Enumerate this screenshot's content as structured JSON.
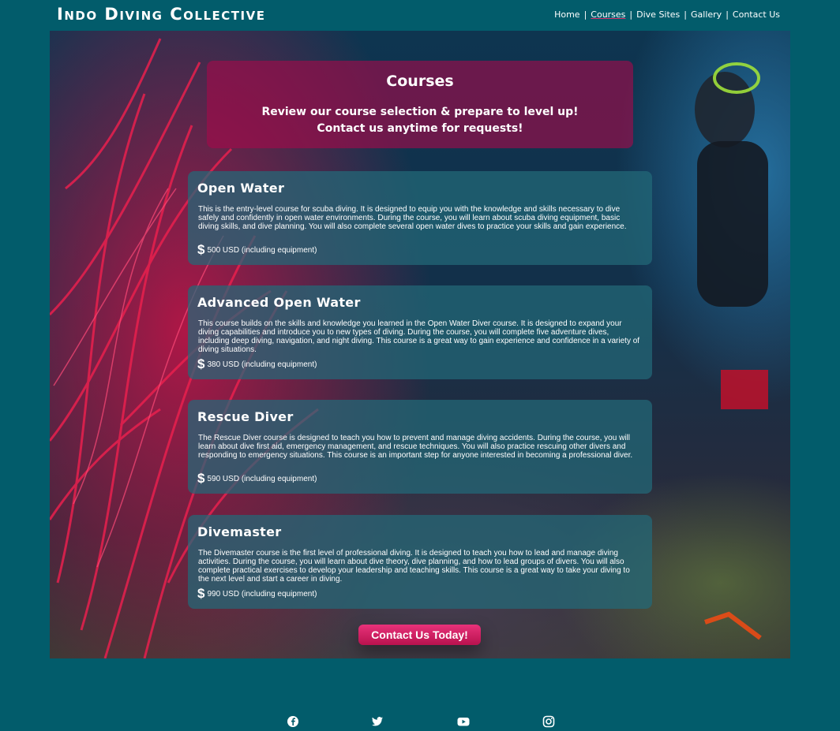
{
  "header": {
    "brand": "Indo Diving Collective",
    "nav": [
      {
        "label": "Home",
        "active": false
      },
      {
        "label": "Courses",
        "active": true
      },
      {
        "label": "Dive Sites",
        "active": false
      },
      {
        "label": "Gallery",
        "active": false
      },
      {
        "label": "Contact Us",
        "active": false
      }
    ],
    "separator": "|"
  },
  "intro": {
    "title": "Courses",
    "line1": "Review our course selection & prepare to level up!",
    "line2": "Contact us anytime for requests!"
  },
  "courses": [
    {
      "title": "Open Water",
      "description": "This is the entry-level course for scuba diving. It is designed to equip you with the knowledge and skills necessary to dive safely and confidently in open water environments. During the course, you will learn about scuba diving equipment, basic diving skills, and dive planning. You will also complete several open water dives to practice your skills and gain experience.",
      "currency_icon": "$",
      "price": "500 USD (including equipment)"
    },
    {
      "title": "Advanced Open Water",
      "description": "This course builds on the skills and knowledge you learned in the Open Water Diver course. It is designed to expand your diving capabilities and introduce you to new types of diving. During the course, you will complete five adventure dives, including deep diving, navigation, and night diving. This course is a great way to gain experience and confidence in a variety of diving situations.",
      "currency_icon": "$",
      "price": "380 USD (including equipment)"
    },
    {
      "title": "Rescue Diver",
      "description": "The Rescue Diver course is designed to teach you how to prevent and manage diving accidents. During the course, you will learn about dive first aid, emergency management, and rescue techniques. You will also practice rescuing other divers and responding to emergency situations. This course is an important step for anyone interested in becoming a professional diver.",
      "currency_icon": "$",
      "price": "590 USD (including equipment)"
    },
    {
      "title": "Divemaster",
      "description": "The Divemaster course is the first level of professional diving. It is designed to teach you how to lead and manage diving activities. During the course, you will learn about dive theory, dive planning, and how to lead groups of divers. You will also complete practical exercises to develop your leadership and teaching skills. This course is a great way to take your diving to the next level and start a career in diving.",
      "currency_icon": "$",
      "price": "990 USD (including equipment)"
    }
  ],
  "cta": {
    "label": "Contact Us Today!"
  },
  "social": [
    "facebook-icon",
    "twitter-icon",
    "youtube-icon",
    "instagram-icon"
  ],
  "colors": {
    "page_background": "#025c6b",
    "accent": "#e0306a",
    "card_background": "#236978"
  }
}
